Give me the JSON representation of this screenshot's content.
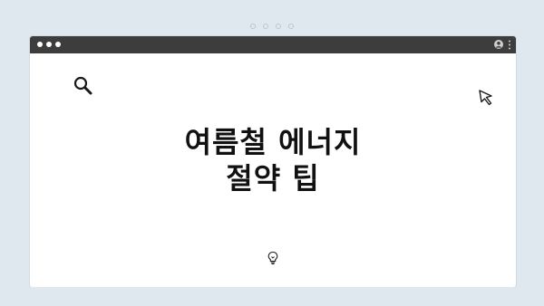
{
  "pager": {
    "count": 4,
    "icon": "page-dot"
  },
  "window": {
    "titlebar": {
      "controls": [
        "dot",
        "dot",
        "dot"
      ],
      "right_icons": [
        "user-icon",
        "kebab-menu-icon"
      ]
    },
    "content": {
      "icons": [
        "search-icon",
        "cursor-icon",
        "bulb-icon"
      ],
      "heading": {
        "line1": "여름철 에너지",
        "line2": "절약 팁"
      }
    }
  },
  "colors": {
    "background": "#dfe8ef",
    "titlebar": "#3d3d3d",
    "content": "#ffffff",
    "text": "#111111"
  }
}
